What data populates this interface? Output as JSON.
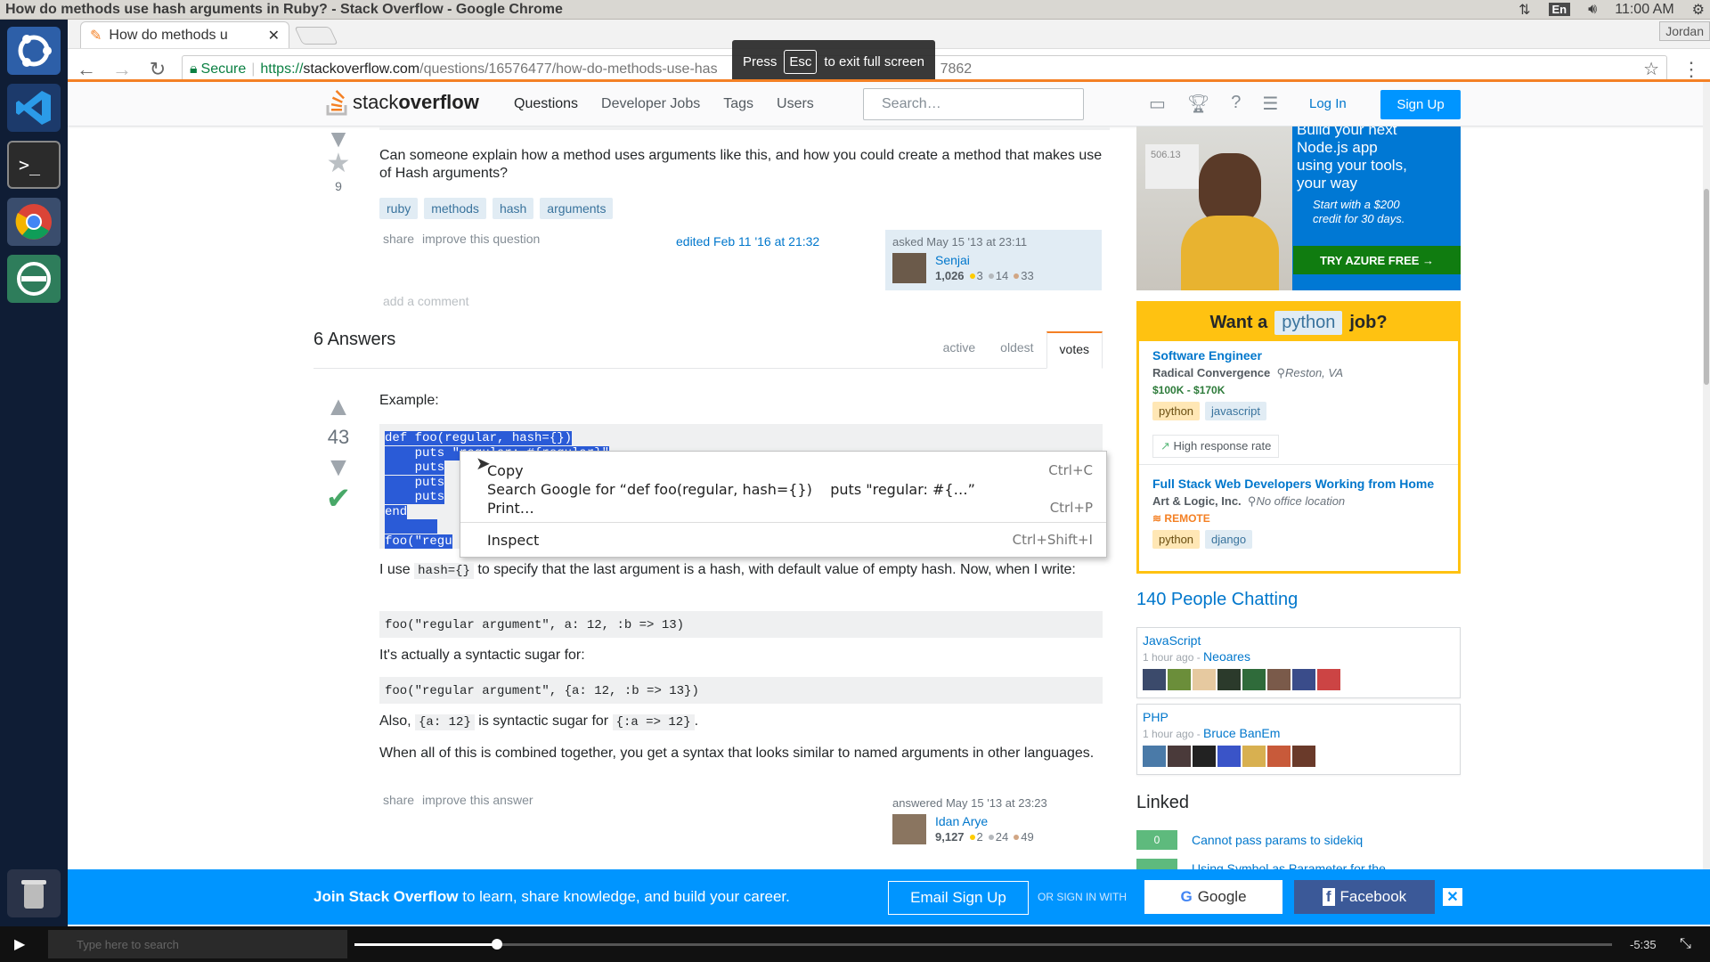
{
  "window": {
    "title": "How do methods use hash arguments in Ruby? - Stack Overflow - Google Chrome",
    "lang": "En",
    "time": "11:00 AM"
  },
  "browser": {
    "tab_title": "How do methods u",
    "profile": "Jordan",
    "secure_label": "Secure",
    "url_scheme": "https://",
    "url_host": "stackoverflow.com",
    "url_path": "/questions/16576477/how-do-methods-use-has",
    "url_tail": "7862",
    "fs_press": "Press",
    "fs_key": "Esc",
    "fs_msg": "to exit full screen"
  },
  "so": {
    "logo_a": "stack",
    "logo_b": "overflow",
    "nav": [
      "Questions",
      "Developer Jobs",
      "Tags",
      "Users"
    ],
    "search_placeholder": "Search…",
    "login": "Log In",
    "signup": "Sign Up"
  },
  "question": {
    "text": "Can someone explain how a method uses arguments like this, and how you could create a method that makes use of Hash arguments?",
    "favorites": "9",
    "tags": [
      "ruby",
      "methods",
      "hash",
      "arguments"
    ],
    "menu": [
      "share",
      "improve this question"
    ],
    "edited": "edited Feb 11 '16 at 21:32",
    "asked": "asked May 15 '13 at 23:11",
    "user": "Senjai",
    "rep": "1,026",
    "gold": "3",
    "silver": "14",
    "bronze": "33",
    "add_comment": "add a comment"
  },
  "answers": {
    "count_label": "6 Answers",
    "sort": [
      "active",
      "oldest",
      "votes"
    ],
    "votes": "43",
    "intro": "Example:",
    "code_lines": [
      "def foo(regular, hash={})",
      "    puts \"regular: #{regular}\"",
      "    puts",
      "    puts",
      "    puts",
      "end",
      "",
      "foo(\"regu"
    ],
    "p1a": "I use",
    "p1code": "hash={}",
    "p1b": "to specify that the last argument is a hash, with default value of empty hash. Now, when I write:",
    "code2": "foo(\"regular argument\", a: 12, :b => 13)",
    "p2": "It's actually a syntactic sugar for:",
    "code3": "foo(\"regular argument\", {a: 12, :b => 13})",
    "p3a": "Also,",
    "p3code1": "{a: 12}",
    "p3b": "is syntactic sugar for",
    "p3code2": "{:a => 12}",
    "p3c": ".",
    "p4": "When all of this is combined together, you get a syntax that looks similar to named arguments in other languages.",
    "menu": [
      "share",
      "improve this answer"
    ],
    "answered": "answered May 15 '13 at 23:23",
    "user": "Idan Arye",
    "rep": "9,127",
    "gold": "2",
    "silver": "24",
    "bronze": "49"
  },
  "context_menu": {
    "items": [
      {
        "label": "Copy",
        "shortcut": "Ctrl+C"
      },
      {
        "label": "Search Google for “def foo(regular, hash={})    puts \"regular: #{…”",
        "shortcut": ""
      },
      {
        "label": "Print…",
        "shortcut": "Ctrl+P"
      },
      {
        "label": "Inspect",
        "shortcut": "Ctrl+Shift+I"
      }
    ]
  },
  "ad": {
    "line1": "Build your next",
    "line2": "Node.js app",
    "line3": "using your tools,",
    "line4": "your way",
    "small1": "Start with a $200",
    "small2": "credit for 30 days.",
    "button": "TRY AZURE FREE  →",
    "badge": "506.13"
  },
  "jobs": {
    "head_a": "Want a",
    "head_tag": "python",
    "head_b": "job?",
    "job1": {
      "title": "Software Engineer",
      "company": "Radical Convergence",
      "location": "Reston, VA",
      "salary": "$100K - $170K",
      "tags": [
        "python",
        "javascript"
      ],
      "perk": "High response rate"
    },
    "job2": {
      "title": "Full Stack Web Developers Working from Home",
      "company": "Art & Logic, Inc.",
      "location": "No office location",
      "remote": "REMOTE",
      "tags": [
        "python",
        "django"
      ]
    }
  },
  "chat": {
    "header": "140 People Chatting",
    "rooms": [
      {
        "name": "JavaScript",
        "ago": "1 hour ago - ",
        "user": "Neoares"
      },
      {
        "name": "PHP",
        "ago": "1 hour ago - ",
        "user": "Bruce BanEm"
      }
    ]
  },
  "linked": {
    "header": "Linked",
    "items": [
      {
        "score": "0",
        "title": "Cannot pass params to sidekiq"
      },
      {
        "score": "",
        "title": "Using Symbol as Parameter for the"
      }
    ]
  },
  "banner": {
    "bold": "Join Stack Overflow",
    "rest": " to learn, share knowledge, and build your career.",
    "email": "Email Sign Up",
    "or": "OR SIGN IN WITH",
    "google": "Google",
    "facebook": "Facebook"
  },
  "player": {
    "search_placeholder": "Type here to search",
    "time": "-5:35",
    "progress": 0.113
  }
}
